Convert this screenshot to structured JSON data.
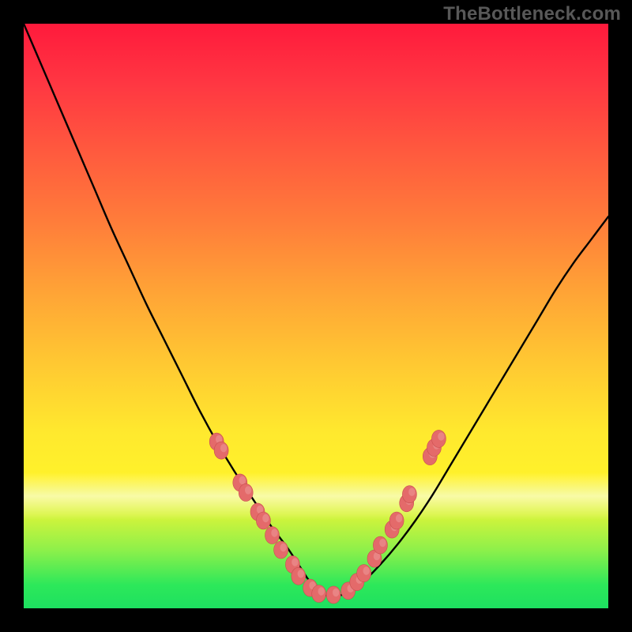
{
  "watermark": "TheBottleneck.com",
  "colors": {
    "curve": "#000000",
    "marker_fill": "#e46a6a",
    "marker_stroke": "#c94f4f",
    "frame_bg": "#000000"
  },
  "chart_data": {
    "type": "line",
    "title": "",
    "xlabel": "",
    "ylabel": "",
    "xlim": [
      0,
      100
    ],
    "ylim": [
      0,
      100
    ],
    "grid": false,
    "series": [
      {
        "name": "bottleneck-curve",
        "x": [
          0,
          3,
          6,
          9,
          12,
          15,
          18,
          21,
          24,
          27,
          30,
          33,
          36,
          39,
          42,
          45,
          47,
          49,
          51,
          53,
          55,
          58,
          61,
          64,
          67,
          70,
          73,
          76,
          79,
          82,
          85,
          88,
          91,
          94,
          97,
          100
        ],
        "y": [
          100,
          93,
          86,
          79,
          72,
          65,
          58.5,
          52,
          46,
          40,
          34,
          28.5,
          23.5,
          19,
          14.5,
          10.5,
          7.5,
          4.5,
          2.5,
          2.2,
          2.5,
          4.5,
          7.5,
          11,
          15,
          19.5,
          24.5,
          29.5,
          34.5,
          39.5,
          44.5,
          49.5,
          54.5,
          59,
          63,
          67
        ]
      }
    ],
    "markers": [
      {
        "x": 33.0,
        "y": 28.5
      },
      {
        "x": 33.8,
        "y": 27.0
      },
      {
        "x": 37.0,
        "y": 21.5
      },
      {
        "x": 38.0,
        "y": 19.8
      },
      {
        "x": 40.0,
        "y": 16.5
      },
      {
        "x": 41.0,
        "y": 15.0
      },
      {
        "x": 42.5,
        "y": 12.5
      },
      {
        "x": 44.0,
        "y": 10.0
      },
      {
        "x": 46.0,
        "y": 7.5
      },
      {
        "x": 47.0,
        "y": 5.5
      },
      {
        "x": 49.0,
        "y": 3.5
      },
      {
        "x": 50.5,
        "y": 2.5
      },
      {
        "x": 53.0,
        "y": 2.3
      },
      {
        "x": 55.5,
        "y": 3.0
      },
      {
        "x": 57.0,
        "y": 4.5
      },
      {
        "x": 58.2,
        "y": 6.0
      },
      {
        "x": 60.0,
        "y": 8.5
      },
      {
        "x": 61.0,
        "y": 10.8
      },
      {
        "x": 63.0,
        "y": 13.5
      },
      {
        "x": 63.8,
        "y": 15.0
      },
      {
        "x": 65.5,
        "y": 18.0
      },
      {
        "x": 66.0,
        "y": 19.5
      },
      {
        "x": 69.5,
        "y": 26.0
      },
      {
        "x": 70.2,
        "y": 27.5
      },
      {
        "x": 71.0,
        "y": 29.0
      }
    ]
  }
}
